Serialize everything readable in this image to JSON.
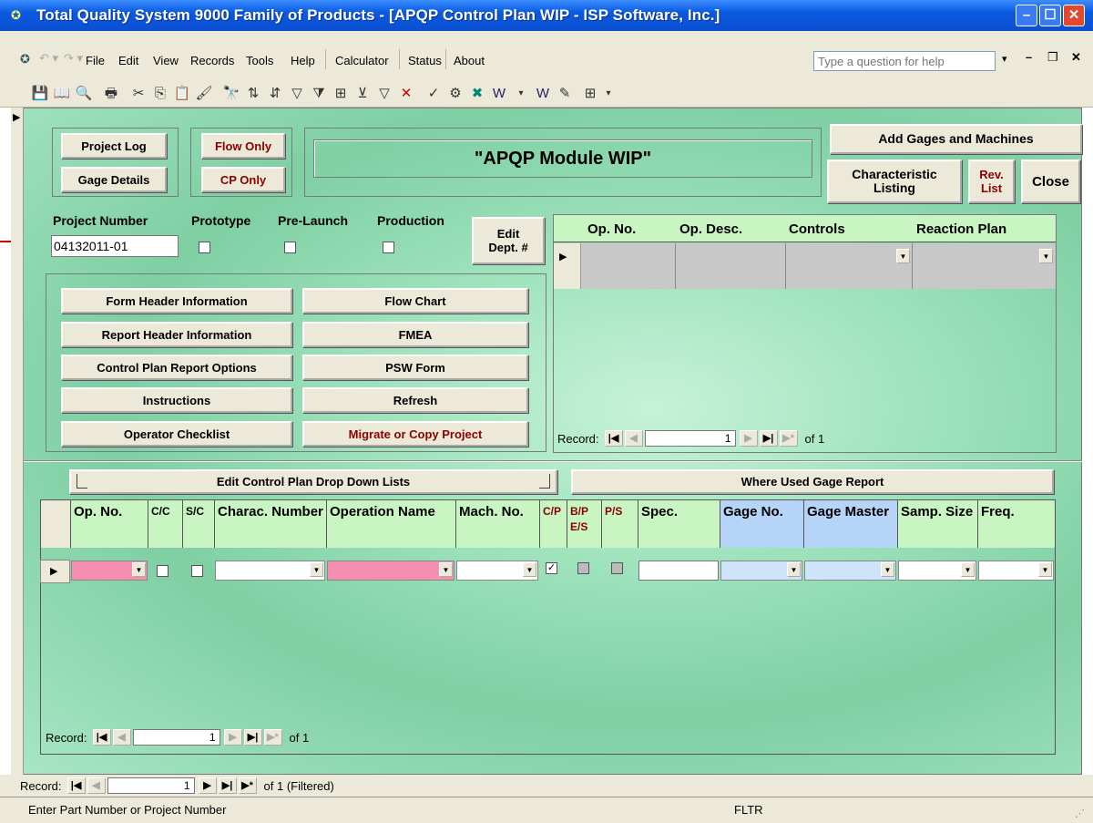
{
  "window": {
    "title": "Total Quality System 9000 Family of Products - [APQP Control Plan WIP - ISP Software, Inc.]"
  },
  "menu": {
    "items": [
      "File",
      "Edit",
      "View",
      "Records",
      "Tools",
      "Help",
      "Calculator",
      "Status",
      "About"
    ],
    "help_placeholder": "Type a question for help"
  },
  "buttons": {
    "project_log": "Project Log",
    "gage_details": "Gage Details",
    "flow_only": "Flow Only",
    "cp_only": "CP Only",
    "module_title": "\"APQP Module WIP\"",
    "add_gages": "Add Gages and Machines",
    "characteristic_listing": "Characteristic Listing",
    "rev_list": "Rev. List",
    "close": "Close",
    "edit_dept": "Edit Dept. #",
    "form_header": "Form Header Information",
    "report_header": "Report Header Information",
    "cp_report_options": "Control Plan Report Options",
    "instructions": "Instructions",
    "operator_checklist": "Operator Checklist",
    "flow_chart": "Flow Chart",
    "fmea": "FMEA",
    "psw_form": "PSW Form",
    "refresh": "Refresh",
    "migrate": "Migrate or Copy Project",
    "edit_cp_dropdown": "Edit Control Plan Drop Down Lists",
    "where_used_gage": "Where Used Gage Report"
  },
  "project": {
    "number_label": "Project Number",
    "number_value": "04132011-01",
    "prototype_label": "Prototype",
    "prelaunch_label": "Pre-Launch",
    "production_label": "Production"
  },
  "subgrid": {
    "columns": [
      "Op. No.",
      "Op. Desc.",
      "Controls",
      "Reaction Plan"
    ],
    "record_label": "Record:",
    "record_value": "1",
    "record_of": "of 1"
  },
  "maingrid": {
    "columns": {
      "op_no": "Op. No.",
      "cc": "C/C",
      "sc": "S/C",
      "charac": "Charac. Number",
      "opname": "Operation Name",
      "mach": "Mach. No.",
      "cp": "C/P",
      "bp": "B/P E/S",
      "ps": "P/S",
      "spec": "Spec.",
      "gageno": "Gage No.",
      "gagemaster": "Gage Master",
      "samp": "Samp. Size",
      "freq": "Freq."
    },
    "record_label": "Record:",
    "record_value": "1",
    "record_of": "of 1"
  },
  "outer_nav": {
    "record_label": "Record:",
    "record_value": "1",
    "record_of": "of 1 (Filtered)"
  },
  "status": {
    "text": "Enter Part Number or Project Number",
    "fltr": "FLTR"
  },
  "colors": {
    "titlebar": "#0b4fd0",
    "form_bg": "#9fe3bd",
    "header_green": "#c9f5c2",
    "header_blue": "#b5d4f7",
    "pink": "#f48fb1",
    "arrow_red": "#d00000"
  }
}
